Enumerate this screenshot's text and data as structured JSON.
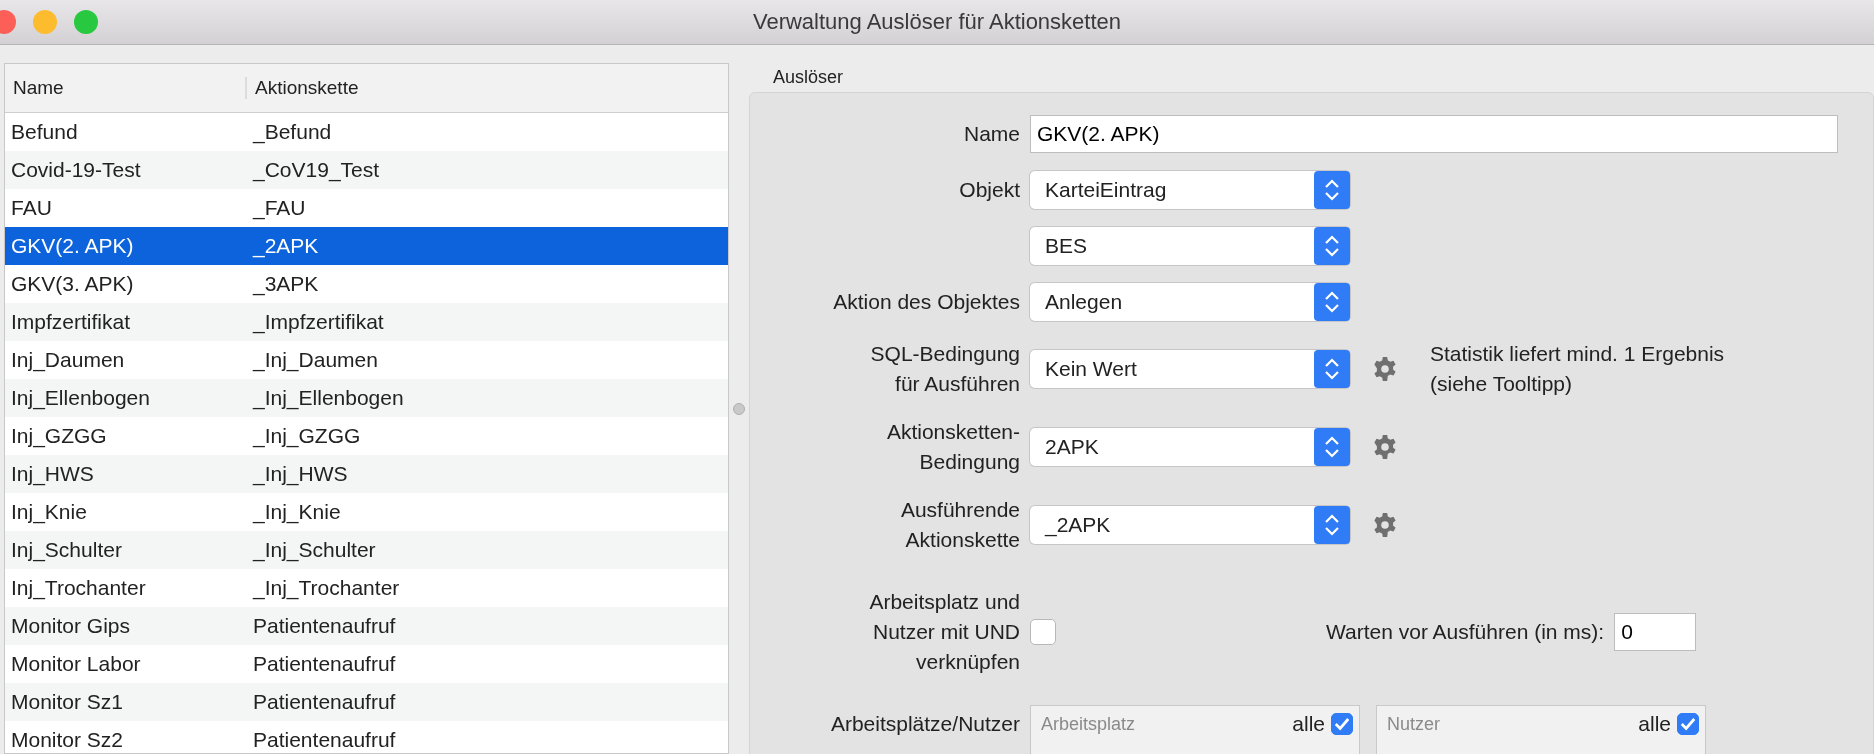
{
  "window": {
    "title": "Verwaltung Auslöser für Aktionsketten"
  },
  "table": {
    "columns": [
      "Name",
      "Aktionskette"
    ],
    "rows": [
      {
        "name": "Befund",
        "chain": "_Befund",
        "selected": false
      },
      {
        "name": "Covid-19-Test",
        "chain": "_CoV19_Test",
        "selected": false
      },
      {
        "name": "FAU",
        "chain": "_FAU",
        "selected": false
      },
      {
        "name": "GKV(2. APK)",
        "chain": "_2APK",
        "selected": true
      },
      {
        "name": "GKV(3. APK)",
        "chain": "_3APK",
        "selected": false
      },
      {
        "name": "Impfzertifikat",
        "chain": "_Impfzertifikat",
        "selected": false
      },
      {
        "name": "Inj_Daumen",
        "chain": "_Inj_Daumen",
        "selected": false
      },
      {
        "name": "Inj_Ellenbogen",
        "chain": "_Inj_Ellenbogen",
        "selected": false
      },
      {
        "name": "Inj_GZGG",
        "chain": "_Inj_GZGG",
        "selected": false
      },
      {
        "name": "Inj_HWS",
        "chain": "_Inj_HWS",
        "selected": false
      },
      {
        "name": "Inj_Knie",
        "chain": "_Inj_Knie",
        "selected": false
      },
      {
        "name": "Inj_Schulter",
        "chain": "_Inj_Schulter",
        "selected": false
      },
      {
        "name": "Inj_Trochanter",
        "chain": "_Inj_Trochanter",
        "selected": false
      },
      {
        "name": "Monitor Gips",
        "chain": "Patientenaufruf",
        "selected": false
      },
      {
        "name": "Monitor Labor",
        "chain": "Patientenaufruf",
        "selected": false
      },
      {
        "name": "Monitor Sz1",
        "chain": "Patientenaufruf",
        "selected": false
      },
      {
        "name": "Monitor Sz2",
        "chain": "Patientenaufruf",
        "selected": false
      }
    ]
  },
  "form": {
    "title": "Auslöser",
    "rows": [
      {
        "kind": "text",
        "label": "Name",
        "value": "GKV(2. APK)"
      },
      {
        "kind": "select",
        "label": "Objekt",
        "value": "KarteiEintrag",
        "settings": false
      },
      {
        "kind": "select",
        "value": "BES",
        "settings": false
      },
      {
        "kind": "select",
        "label": "Aktion des Objektes",
        "value": "Anlegen",
        "settings": false
      },
      {
        "kind": "select",
        "label": "SQL-Bedingung\nfür Ausführen",
        "value": "Kein Wert",
        "settings": true,
        "note": "Statistik liefert mind. 1 Ergebnis\n(siehe Tooltipp)"
      },
      {
        "kind": "select",
        "label": "Aktionsketten-\nBedingung",
        "value": "2APK",
        "settings": true
      },
      {
        "kind": "select",
        "label": "Ausführende\nAktionskette",
        "value": "_2APK",
        "settings": true
      },
      {
        "kind": "check-wait",
        "label": "Arbeitsplatz und\nNutzer mit UND\nverknüpfen",
        "checked": false,
        "wait_label": "Warten vor Ausführen (in ms):",
        "wait_value": "0"
      },
      {
        "kind": "lists",
        "label": "Arbeitsplätze/Nutzer",
        "lists": [
          {
            "placeholder": "Arbeitsplatz",
            "all_label": "alle",
            "all_checked": true
          },
          {
            "placeholder": "Nutzer",
            "all_label": "alle",
            "all_checked": true
          }
        ]
      }
    ]
  }
}
